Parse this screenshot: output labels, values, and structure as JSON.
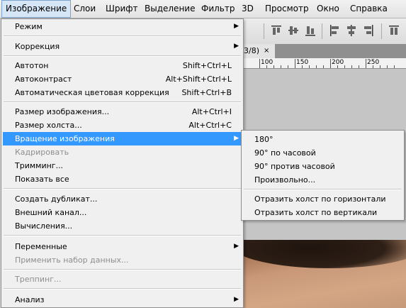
{
  "menubar": {
    "items": [
      {
        "label": "Изображение"
      },
      {
        "label": "Слои"
      },
      {
        "label": "Шрифт"
      },
      {
        "label": "Выделение"
      },
      {
        "label": "Фильтр"
      },
      {
        "label": "3D"
      },
      {
        "label": "Просмотр"
      },
      {
        "label": "Окно"
      },
      {
        "label": "Справка"
      }
    ]
  },
  "workspace": {
    "doc_tab": "3/8)",
    "close_glyph": "×",
    "ruler": [
      "100",
      "150",
      "200",
      "250"
    ],
    "toolbar_icons": [
      "align-top-edges-icon",
      "align-vertical-centers-icon",
      "align-bottom-edges-icon",
      "align-left-edges-icon",
      "align-horizontal-centers-icon",
      "align-right-edges-icon",
      "distribute-icon"
    ]
  },
  "menu": {
    "items": [
      {
        "label": "Режим",
        "submenu": true
      },
      {
        "label": "Коррекция",
        "submenu": true
      },
      {
        "label": "Автотон",
        "shortcut": "Shift+Ctrl+L"
      },
      {
        "label": "Автоконтраст",
        "shortcut": "Alt+Shift+Ctrl+L"
      },
      {
        "label": "Автоматическая цветовая коррекция",
        "shortcut": "Shift+Ctrl+B"
      },
      {
        "label": "Размер изображения...",
        "shortcut": "Alt+Ctrl+I"
      },
      {
        "label": "Размер холста...",
        "shortcut": "Alt+Ctrl+C"
      },
      {
        "label": "Вращение изображения",
        "submenu": true,
        "highlighted": true
      },
      {
        "label": "Кадрировать",
        "disabled": true
      },
      {
        "label": "Тримминг..."
      },
      {
        "label": "Показать все"
      },
      {
        "label": "Создать дубликат..."
      },
      {
        "label": "Внешний канал..."
      },
      {
        "label": "Вычисления..."
      },
      {
        "label": "Переменные",
        "submenu": true
      },
      {
        "label": "Применить набор данных...",
        "disabled": true
      },
      {
        "label": "Треппинг...",
        "disabled": true
      },
      {
        "label": "Анализ",
        "submenu": true
      }
    ]
  },
  "submenu": {
    "items": [
      {
        "label": "180°"
      },
      {
        "label": "90° по часовой"
      },
      {
        "label": "90° против часовой"
      },
      {
        "label": "Произвольно..."
      },
      {
        "label": "Отразить холст по горизонтали"
      },
      {
        "label": "Отразить холст по вертикали"
      }
    ]
  },
  "colors": {
    "highlight": "#3399ff",
    "menu_bg": "#f0f0f0",
    "disabled_text": "#8e8e8e"
  }
}
